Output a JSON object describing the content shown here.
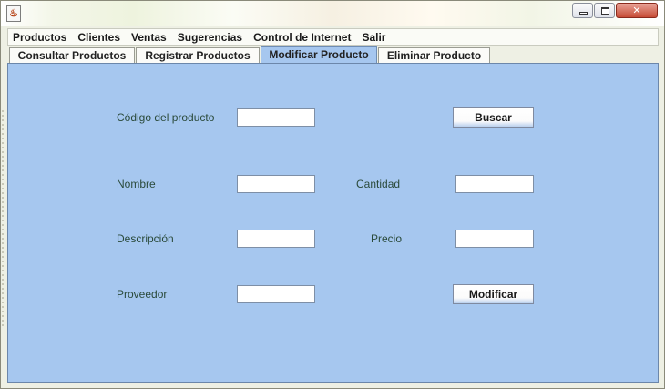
{
  "window": {
    "app_icon_glyph": "♨",
    "controls": {
      "minimize_icon": "minimize-icon",
      "maximize_icon": "maximize-icon",
      "close_icon": "close-icon",
      "close_glyph": "✕"
    }
  },
  "menubar": {
    "items": [
      "Productos",
      "Clientes",
      "Ventas",
      "Sugerencias",
      "Control de Internet",
      "Salir"
    ]
  },
  "tabs": {
    "items": [
      "Consultar Productos",
      "Registrar Productos",
      "Modificar Producto",
      "Eliminar Producto"
    ],
    "selected": "Modificar Producto"
  },
  "form": {
    "codigo_label": "Código del producto",
    "codigo_value": "",
    "buscar_label": "Buscar",
    "nombre_label": "Nombre",
    "nombre_value": "",
    "cantidad_label": "Cantidad",
    "cantidad_value": "",
    "descripcion_label": "Descripción",
    "descripcion_value": "",
    "precio_label": "Precio",
    "precio_value": "",
    "proveedor_label": "Proveedor",
    "proveedor_value": "",
    "modificar_label": "Modificar"
  },
  "colors": {
    "panel_bg": "#a6c7ef",
    "menubar_bg": "#fafbf6",
    "label_text": "#2a4a3a",
    "close_button": "#c64b36"
  }
}
